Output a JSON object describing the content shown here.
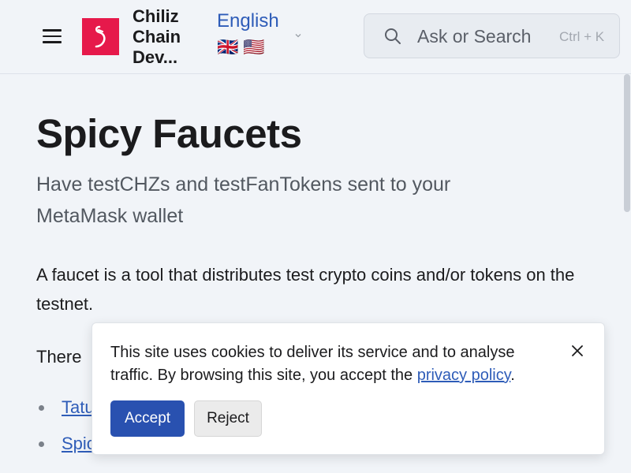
{
  "header": {
    "brand_line1": "Chiliz",
    "brand_line2": "Chain",
    "brand_line3": "Dev...",
    "language": "English",
    "flags": "🇬🇧🇺🇸",
    "search_placeholder": "Ask or Search",
    "search_shortcut": "Ctrl + K"
  },
  "main": {
    "title": "Spicy Faucets",
    "subtitle": "Have testCHZs and testFanTokens sent to your MetaMask wallet",
    "paragraph": "A  faucet is a tool that distributes test crypto coins and/or tokens on the testnet.",
    "paragraph2": "There",
    "links": [
      {
        "label": "Tatum"
      },
      {
        "label": "Spicy Faucet"
      }
    ]
  },
  "cookie": {
    "text": "This site uses cookies to deliver its service and to analyse traffic. By browsing this site, you accept the ",
    "link": "privacy policy",
    "suffix": ".",
    "accept": "Accept",
    "reject": "Reject"
  },
  "colors": {
    "brand": "#e6194b",
    "link": "#2e5cb8",
    "accept_button": "#2951b0"
  }
}
